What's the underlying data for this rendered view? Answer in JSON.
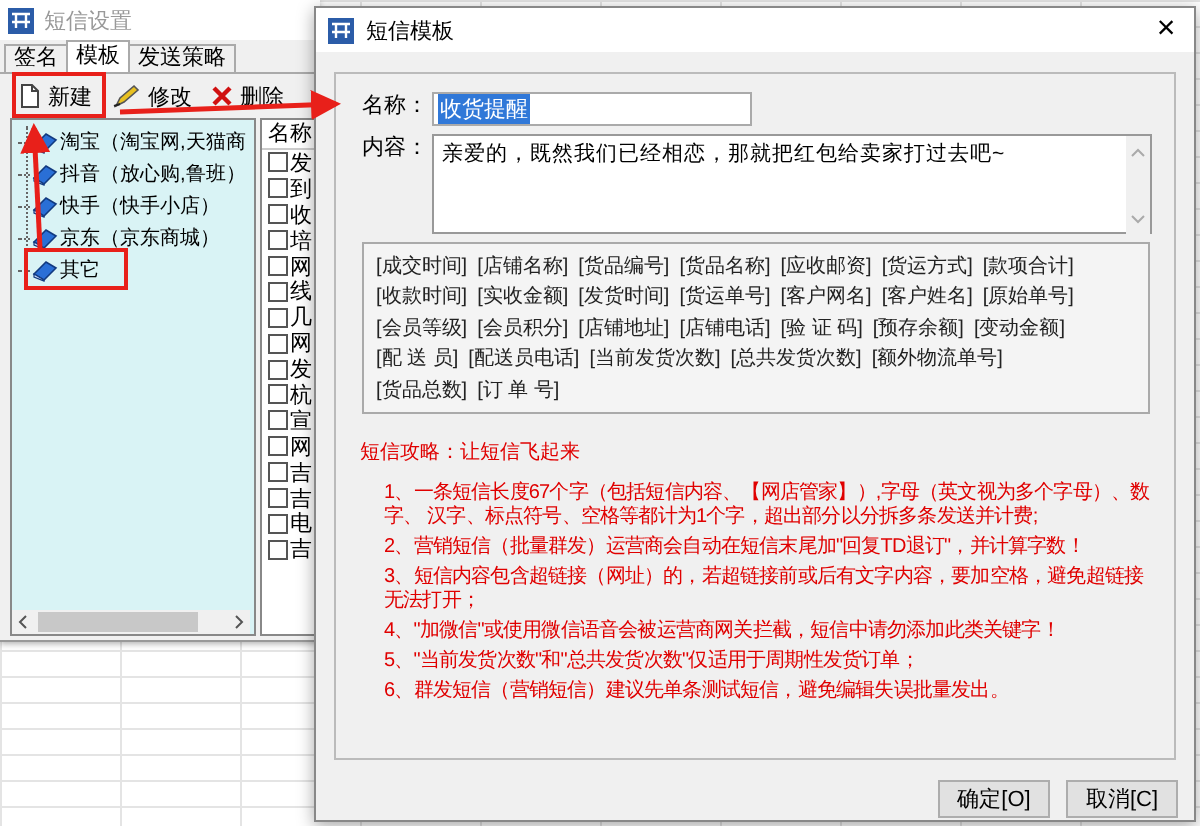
{
  "settings_window": {
    "title": "短信设置",
    "tabs": [
      {
        "label": "签名",
        "selected": false
      },
      {
        "label": "模板",
        "selected": true
      },
      {
        "label": "发送策略",
        "selected": false
      }
    ],
    "toolbar": [
      {
        "label": "新建",
        "kind": "new"
      },
      {
        "label": "修改",
        "kind": "edit"
      },
      {
        "label": "删除",
        "kind": "delete"
      }
    ],
    "tree": [
      {
        "label": "淘宝（淘宝网,天猫商"
      },
      {
        "label": "抖音（放心购,鲁班）"
      },
      {
        "label": "快手（快手小店）"
      },
      {
        "label": "京东（京东商城）"
      },
      {
        "label": "其它"
      }
    ],
    "list": {
      "header": "名称",
      "rows": [
        {
          "name": "发",
          "checked": false
        },
        {
          "name": "到",
          "checked": false
        },
        {
          "name": "收",
          "checked": false
        },
        {
          "name": "培",
          "checked": false
        },
        {
          "name": "网",
          "checked": false
        },
        {
          "name": "线",
          "checked": false
        },
        {
          "name": "几",
          "checked": false
        },
        {
          "name": "网",
          "checked": false
        },
        {
          "name": "发",
          "checked": false
        },
        {
          "name": "杭",
          "checked": false
        },
        {
          "name": "宣",
          "checked": false
        },
        {
          "name": "网",
          "checked": false
        },
        {
          "name": "吉",
          "checked": false
        },
        {
          "name": "吉",
          "checked": false
        },
        {
          "name": "电",
          "checked": false
        },
        {
          "name": "吉",
          "checked": false
        }
      ]
    }
  },
  "template_dialog": {
    "title": "短信模板",
    "close": "×",
    "name_label": "名称：",
    "name_value": "收货提醒",
    "name_text_selected": true,
    "content_label": "内容：",
    "content_value": "亲爱的，既然我们已经相恋，那就把红包给卖家打过去吧~",
    "tag_rows": [
      [
        "[成交时间]",
        "[店铺名称]",
        "[货品编号]",
        "[货品名称]",
        "[应收邮资]",
        "[货运方式]",
        "[款项合计]"
      ],
      [
        "[收款时间]",
        "[实收金额]",
        "[发货时间]",
        "[货运单号]",
        "[客户网名]",
        "[客户姓名]",
        "[原始单号]"
      ],
      [
        "[会员等级]",
        "[会员积分]",
        "[店铺地址]",
        "[店铺电话]",
        "[验 证 码]",
        "[预存余额]",
        "[变动金额]"
      ],
      [
        "[配 送 员]",
        "[配送员电话]",
        "[当前发货次数]",
        "[总共发货次数]",
        "[额外物流单号]"
      ],
      [
        "[货品总数]",
        "[订 单 号]"
      ]
    ],
    "tips_title": "短信攻略：让短信飞起来",
    "tips": [
      "1、一条短信长度67个字（包括短信内容、【网店管家】）,字母（英文视为多个字母）、数字、 汉字、标点符号、空格等都计为1个字，超出部分以分拆多条发送并计费;",
      "2、营销短信（批量群发）运营商会自动在短信末尾加\"回复TD退订\"，并计算字数！",
      "3、短信内容包含超链接（网址）的，若超链接前或后有文字内容，要加空格，避免超链接无法打开；",
      "4、\"加微信\"或使用微信语音会被运营商网关拦截，短信中请勿添加此类关键字！",
      "5、\"当前发货次数\"和\"总共发货次数\"仅适用于周期性发货订单；",
      "6、群发短信（营销短信）建议先单条测试短信，避免编辑失误批量发出。"
    ],
    "buttons": [
      "确定[O]",
      "取消[C]"
    ]
  }
}
